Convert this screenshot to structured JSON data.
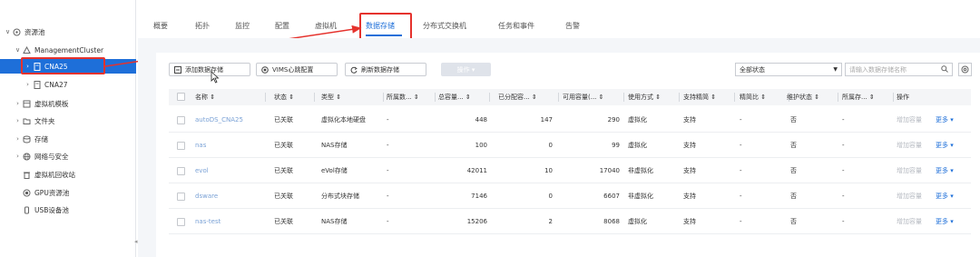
{
  "sidebar": {
    "items": [
      {
        "label": "资源池",
        "chevron": "∨",
        "icon": "resource-pool-icon"
      },
      {
        "label": "ManagementCluster",
        "chevron": "∨",
        "icon": "cluster-icon"
      },
      {
        "label": "CNA25",
        "chevron": "›",
        "icon": "host-icon"
      },
      {
        "label": "CNA27",
        "chevron": "›",
        "icon": "host-icon"
      },
      {
        "label": "虚拟机模板",
        "chevron": "›",
        "icon": "template-icon"
      },
      {
        "label": "文件夹",
        "chevron": "›",
        "icon": "folder-icon"
      },
      {
        "label": "存储",
        "chevron": "›",
        "icon": "storage-icon"
      },
      {
        "label": "网络与安全",
        "chevron": "›",
        "icon": "network-icon"
      },
      {
        "label": "虚拟机回收站",
        "chevron": "",
        "icon": "recycle-bin-icon"
      },
      {
        "label": "GPU资源池",
        "chevron": "",
        "icon": "gpu-icon"
      },
      {
        "label": "USB设备池",
        "chevron": "",
        "icon": "usb-icon"
      }
    ],
    "scroll_glyph": "◂"
  },
  "tabs": [
    {
      "label": "概要"
    },
    {
      "label": "拓扑"
    },
    {
      "label": "监控"
    },
    {
      "label": "配置"
    },
    {
      "label": "虚拟机"
    },
    {
      "label": "数据存储"
    },
    {
      "label": "分布式交换机"
    },
    {
      "label": "任务和事件"
    },
    {
      "label": "告警"
    }
  ],
  "active_tab": "数据存储",
  "toolbar": {
    "add_label": "添加数据存储",
    "vims_label": "VIMS心跳配置",
    "refresh_label": "刷新数据存储",
    "ops_label": "操作 ▾",
    "status_select": "全部状态",
    "search_placeholder": "请输入数据存储名称"
  },
  "table": {
    "headers": [
      "名称 ⇕",
      "状态 ⇕",
      "类型 ⇕",
      "所属数... ⇕",
      "总容量... ⇕",
      "已分配容... ⇕",
      "可用容量(... ⇕",
      "使用方式 ⇕",
      "支持精简 ⇕",
      "精简比 ⇕",
      "维护状态 ⇕",
      "所属存... ⇕",
      "操作"
    ],
    "rows": [
      {
        "name": "autoDS_CNA25",
        "status": "已关联",
        "type": "虚拟化本地硬盘",
        "belong": "-",
        "total": "448",
        "allocated": "147",
        "available": "290",
        "mode": "虚拟化",
        "thin": "支持",
        "thin_ratio": "-",
        "maintenance": "否",
        "storage": "-",
        "op1": "增加容量",
        "op2": "更多 ▾"
      },
      {
        "name": "nas",
        "status": "已关联",
        "type": "NAS存储",
        "belong": "-",
        "total": "100",
        "allocated": "0",
        "available": "99",
        "mode": "虚拟化",
        "thin": "支持",
        "thin_ratio": "-",
        "maintenance": "否",
        "storage": "-",
        "op1": "增加容量",
        "op2": "更多 ▾"
      },
      {
        "name": "evol",
        "status": "已关联",
        "type": "eVol存储",
        "belong": "-",
        "total": "42011",
        "allocated": "10",
        "available": "17040",
        "mode": "非虚拟化",
        "thin": "支持",
        "thin_ratio": "-",
        "maintenance": "否",
        "storage": "-",
        "op1": "增加容量",
        "op2": "更多 ▾"
      },
      {
        "name": "dsware",
        "status": "已关联",
        "type": "分布式块存储",
        "belong": "-",
        "total": "7146",
        "allocated": "0",
        "available": "6607",
        "mode": "非虚拟化",
        "thin": "支持",
        "thin_ratio": "-",
        "maintenance": "否",
        "storage": "-",
        "op1": "增加容量",
        "op2": "更多 ▾"
      },
      {
        "name": "nas-test",
        "status": "已关联",
        "type": "NAS存储",
        "belong": "-",
        "total": "15206",
        "allocated": "2",
        "available": "8068",
        "mode": "虚拟化",
        "thin": "支持",
        "thin_ratio": "-",
        "maintenance": "否",
        "storage": "-",
        "op1": "增加容量",
        "op2": "更多 ▾"
      }
    ]
  },
  "colors": {
    "accent": "#1e6fd9",
    "highlight_red": "#e5322d",
    "link": "#7ba2d6"
  }
}
